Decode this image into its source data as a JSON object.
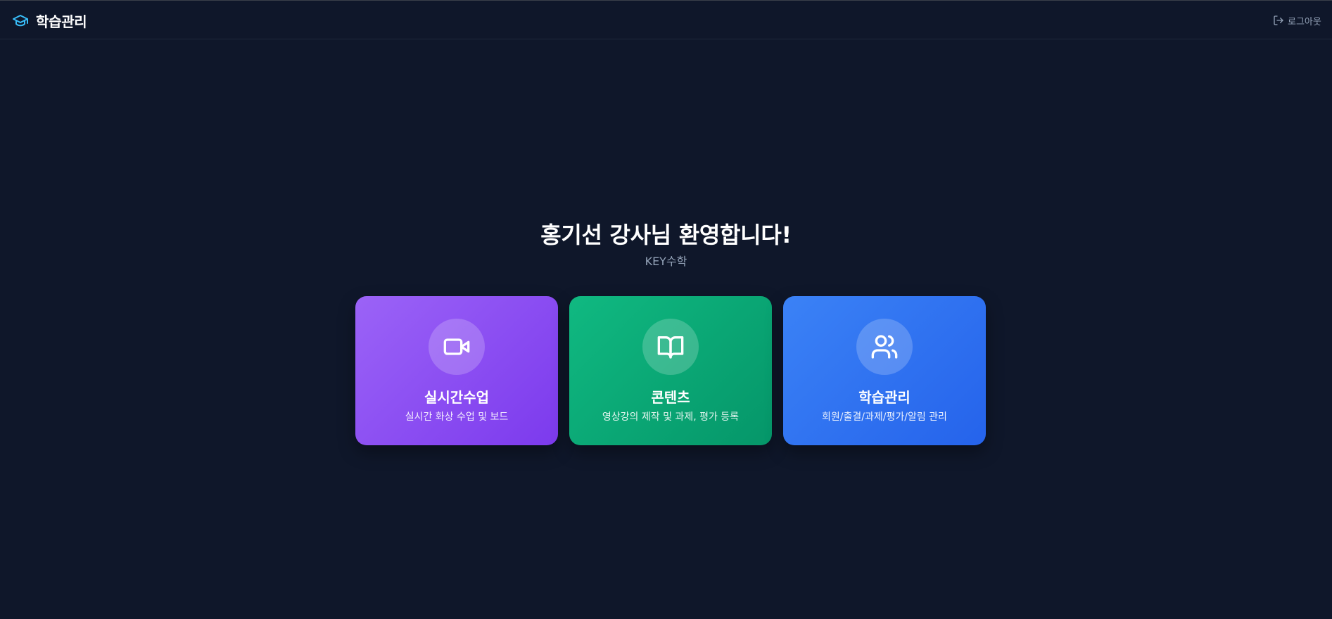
{
  "header": {
    "brand_icon": "graduation-cap-icon",
    "brand_icon_color": "#38bdf8",
    "brand_title": "학습관리",
    "logout_icon": "logout-icon",
    "logout_label": "로그아웃"
  },
  "main": {
    "welcome": "홍기선 강사님 환영합니다!",
    "organization": "KEY수학",
    "cards": [
      {
        "icon": "video-camera-icon",
        "title": "실시간수업",
        "description": "실시간 화상 수업 및 보드",
        "color": "#8b5cf6"
      },
      {
        "icon": "open-book-icon",
        "title": "콘텐츠",
        "description": "영상강의 제작 및 과제, 평가 등록",
        "color": "#10b981"
      },
      {
        "icon": "users-icon",
        "title": "학습관리",
        "description": "회원/출결/과제/평가/알림 관리",
        "color": "#3b82f6"
      }
    ]
  },
  "colors": {
    "background": "#0f172a",
    "muted_text": "#94a3b8"
  }
}
